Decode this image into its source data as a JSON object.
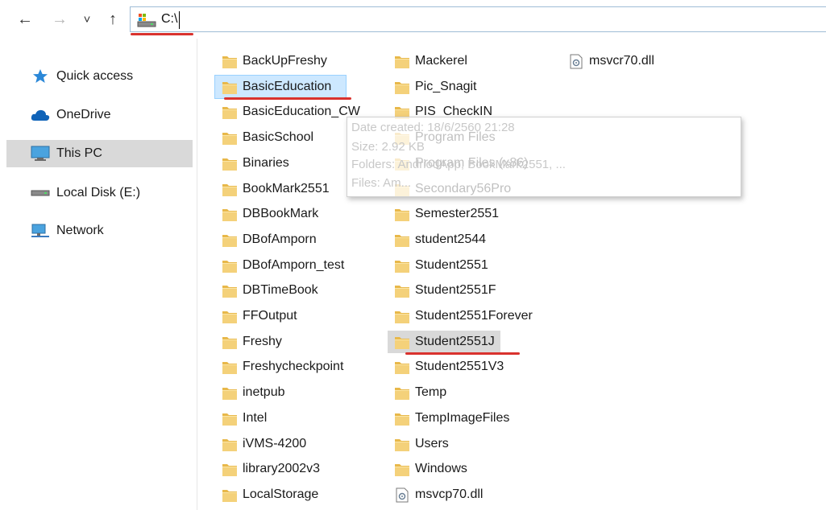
{
  "nav": {
    "back_glyph": "←",
    "forward_glyph": "→",
    "recent_glyph": "˅",
    "up_glyph": "↑"
  },
  "address_bar": {
    "value": "C:\\",
    "icon": "drive-icon"
  },
  "sidebar": {
    "items": [
      {
        "label": "Quick access",
        "icon": "star-icon"
      },
      {
        "label": "OneDrive",
        "icon": "cloud-icon"
      },
      {
        "label": "This PC",
        "icon": "computer-icon"
      },
      {
        "label": "Local Disk (E:)",
        "icon": "disk-icon"
      },
      {
        "label": "Network",
        "icon": "network-icon"
      }
    ]
  },
  "files": {
    "col1": [
      "BackUpFreshy",
      "BasicEducation",
      "BasicEducation_CW",
      "BasicSchool",
      "Binaries",
      "BookMark2551",
      "DBBookMark",
      "DBofAmporn",
      "DBofAmporn_test",
      "DBTimeBook",
      "FFOutput",
      "Freshy",
      "Freshycheckpoint",
      "inetpub",
      "Intel",
      "iVMS-4200",
      "library2002v3",
      "LocalStorage"
    ],
    "col2": [
      "Mackerel",
      "Pic_Snagit",
      "PIS_CheckIN",
      "Program Files",
      "Program Files (x86)",
      "Secondary56Pro",
      "Semester2551",
      "student2544",
      "Student2551",
      "Student2551F",
      "Student2551Forever",
      "Student2551J",
      "Student2551V3",
      "Temp",
      "TempImageFiles",
      "Users",
      "Windows",
      "msvcp70.dll"
    ],
    "col3": [
      "msvcr70.dll"
    ]
  },
  "tooltip": {
    "line1": "Date created: 18/6/2560 21:28",
    "line2": "Size: 2.92 KB",
    "line3": "Folders: AndriodApp, BookMark2551, ...",
    "line4": "Files: Am..."
  },
  "colors": {
    "selection_blue": "#cde8ff",
    "selection_gray": "#d9d9d9",
    "annotation_red": "#d9322e",
    "folder_yellow": "#f4d17a"
  }
}
